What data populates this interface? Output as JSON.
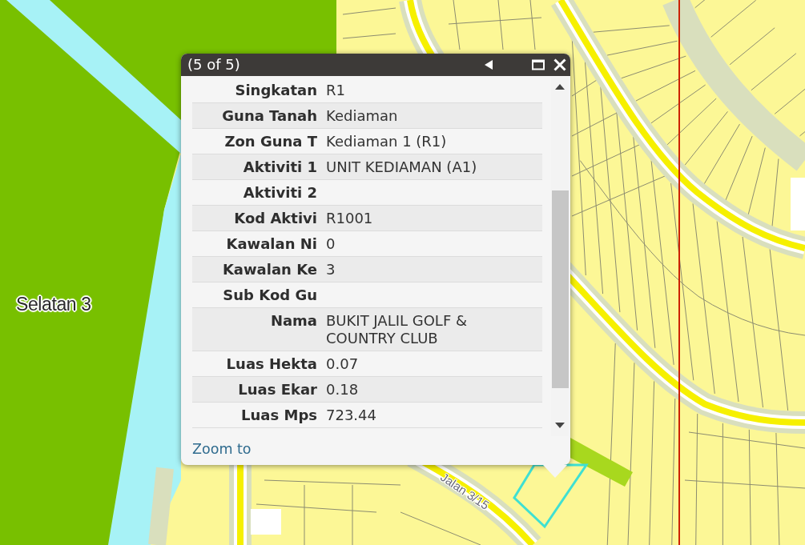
{
  "popup": {
    "title": "(5 of 5)",
    "fields": [
      {
        "label": "Singkatan",
        "value": "R1"
      },
      {
        "label": "Guna Tanah",
        "value": "Kediaman"
      },
      {
        "label": "Zon Guna T",
        "value": "Kediaman 1 (R1)"
      },
      {
        "label": "Aktiviti 1",
        "value": "UNIT KEDIAMAN (A1)"
      },
      {
        "label": "Aktiviti 2"
      },
      {
        "label": "Kod Aktivi",
        "value": "R1001"
      },
      {
        "label": "Kawalan Ni",
        "value": "0"
      },
      {
        "label": "Kawalan Ke",
        "value": "3"
      },
      {
        "label": "Sub Kod Gu"
      },
      {
        "label": "Nama",
        "value": "BUKIT JALIL GOLF & COUNTRY CLUB"
      },
      {
        "label": "Luas Hekta",
        "value": "0.07"
      },
      {
        "label": "Luas Ekar",
        "value": "0.18"
      },
      {
        "label": "Luas Mps",
        "value": "723.44"
      }
    ],
    "link": "Zoom to"
  },
  "map": {
    "labels": [
      {
        "kind": "area",
        "text": "Selatan 3"
      },
      {
        "kind": "road",
        "text": "Jalan 3/15"
      }
    ]
  }
}
